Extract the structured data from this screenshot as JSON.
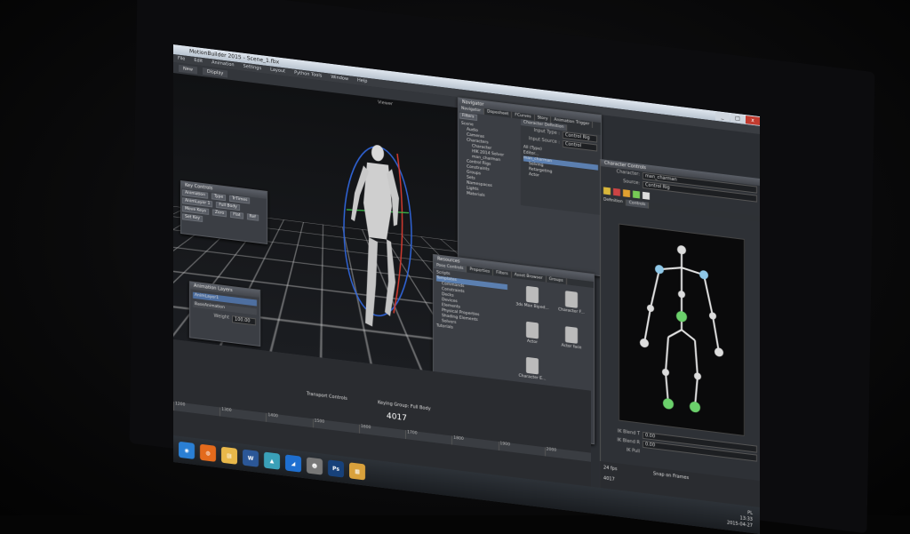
{
  "window": {
    "title": "MotionBuilder 2015 - Scene_1.fbx",
    "minimize": "_",
    "maximize": "□",
    "close": "x"
  },
  "menu": [
    "File",
    "Edit",
    "Animation",
    "Settings",
    "Layout",
    "Python Tools",
    "Window",
    "Help"
  ],
  "toolbar": {
    "new": "New",
    "display": "Display"
  },
  "viewport": {
    "label": "Viewer"
  },
  "key_controls": {
    "title": "Key Controls",
    "animation_label": "Animation",
    "type_label": "Type",
    "type_value": "TrTimes",
    "anim_layer_label": "AnimLayer 1",
    "full_body": "Full Body",
    "move_keys": "Move Keys",
    "zero": "Zero",
    "flat": "Flat",
    "ref": "Ref",
    "set_key": "Set Key"
  },
  "animation_layers": {
    "title": "Animation Layers",
    "layer1": "AnimLayer1",
    "base": "BaseAnimation",
    "weight_label": "Weight",
    "weight_value": "100.00"
  },
  "navigator": {
    "title": "Navigator",
    "tabs": [
      "Navigator",
      "Dopesheet",
      "FCurves",
      "Story",
      "Animation Trigger"
    ],
    "filters": "Filters",
    "tree": [
      {
        "label": "Scene",
        "level": 0
      },
      {
        "label": "Audio",
        "level": 1
      },
      {
        "label": "Cameras",
        "level": 1
      },
      {
        "label": "Characters",
        "level": 1
      },
      {
        "label": "Character",
        "level": 2
      },
      {
        "label": "HIK 2014 Solver",
        "level": 2
      },
      {
        "label": "man_charman",
        "level": 2
      },
      {
        "label": "Control Rigs",
        "level": 1
      },
      {
        "label": "Constraints",
        "level": 1
      },
      {
        "label": "Groups",
        "level": 1
      },
      {
        "label": "Sets",
        "level": 1
      },
      {
        "label": "Namespaces",
        "level": 1
      },
      {
        "label": "Lights",
        "level": 1
      },
      {
        "label": "Materials",
        "level": 1
      }
    ]
  },
  "char_definition": {
    "tab": "Character Definition",
    "input_type_label": "Input Type :",
    "input_type_value": "Control Rig",
    "input_source_label": "Input Source :",
    "input_source_value": "Control",
    "all_type": "All (Type)",
    "editor": "Editor...",
    "char_name": "man_charman",
    "solving": "Solving",
    "retargeting": "Retargeting",
    "actor": "Actor"
  },
  "resources": {
    "title": "Resources",
    "tabs": [
      "Pose Controls",
      "Properties",
      "Filters",
      "Asset Browser",
      "Groups"
    ],
    "tree": [
      {
        "label": "Scripts",
        "level": 0
      },
      {
        "label": "Templates",
        "level": 0,
        "selected": true
      },
      {
        "label": "Commands",
        "level": 1
      },
      {
        "label": "Constraints",
        "level": 1
      },
      {
        "label": "Decks",
        "level": 1
      },
      {
        "label": "Devices",
        "level": 1
      },
      {
        "label": "Elements",
        "level": 1
      },
      {
        "label": "Physical Properties",
        "level": 1
      },
      {
        "label": "Shading Elements",
        "level": 1
      },
      {
        "label": "Solvers",
        "level": 1
      },
      {
        "label": "Tutorials",
        "level": 0
      }
    ],
    "assets": [
      "3ds Max Biped...",
      "Character F...",
      "Actor",
      "Actor face",
      "Character E..."
    ]
  },
  "character_controls": {
    "title": "Character Controls",
    "character_label": "Character:",
    "character_value": "man_charman",
    "source_label": "Source:",
    "source_value": "Control Rig",
    "tab_definition": "Definition",
    "tab_controls": "Controls",
    "ik_blend_t": "IK Blend T",
    "ik_blend_r": "IK Blend R",
    "ik_pull": "IK Pull",
    "value_1": "0.00",
    "value_2": "0.00"
  },
  "transport": {
    "title": "Transport Controls",
    "playing": "Keying Group: Full Body",
    "speed": "24 fps",
    "snap": "Snap on Frames",
    "frame_in": "4017",
    "frame_out": "4017",
    "ruler": [
      "1200",
      "1300",
      "1400",
      "1500",
      "1600",
      "1700",
      "1800",
      "1900",
      "2000"
    ]
  },
  "taskbar": {
    "apps": [
      {
        "name": "windows-start-icon",
        "glyph": "◉",
        "color": "#2a7fd4"
      },
      {
        "name": "firefox-icon",
        "glyph": "◍",
        "color": "#e36a1c"
      },
      {
        "name": "explorer-icon",
        "glyph": "▤",
        "color": "#e8b84a"
      },
      {
        "name": "word-icon",
        "glyph": "W",
        "color": "#2b5797"
      },
      {
        "name": "app-icon",
        "glyph": "▲",
        "color": "#3aa0b8"
      },
      {
        "name": "motionbuilder-icon",
        "glyph": "◢",
        "color": "#1e6fd0"
      },
      {
        "name": "alien-icon",
        "glyph": "☻",
        "color": "#777"
      },
      {
        "name": "photoshop-icon",
        "glyph": "Ps",
        "color": "#17417a"
      },
      {
        "name": "notes-icon",
        "glyph": "▦",
        "color": "#d9a13c"
      }
    ],
    "lang": "PL",
    "time": "13:33",
    "date": "2015-04-27"
  }
}
